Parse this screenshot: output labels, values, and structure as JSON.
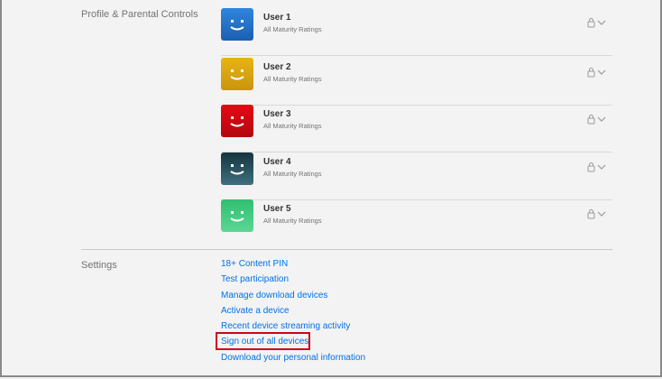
{
  "profiles_section": {
    "label": "Profile & Parental Controls",
    "users": [
      {
        "name": "User 1",
        "rating": "All Maturity Ratings",
        "color": "#2e86de",
        "color_dark": "#1c5fb0"
      },
      {
        "name": "User 2",
        "rating": "All Maturity Ratings",
        "color": "#e7b416",
        "color_dark": "#c9950e"
      },
      {
        "name": "User 3",
        "rating": "All Maturity Ratings",
        "color": "#e50914",
        "color_dark": "#b20710"
      },
      {
        "name": "User 4",
        "rating": "All Maturity Ratings",
        "color": "#15353f",
        "color_dark": "#3f6f7f"
      },
      {
        "name": "User 5",
        "rating": "All Maturity Ratings",
        "color": "#2fbf71",
        "color_dark": "#5cd693"
      }
    ],
    "row_icons": [
      "lock-icon",
      "chevron-down-icon"
    ]
  },
  "settings_section": {
    "label": "Settings",
    "links": [
      "18+ Content PIN",
      "Test participation",
      "Manage download devices",
      "Activate a device",
      "Recent device streaming activity",
      "Sign out of all devices",
      "Download your personal information"
    ],
    "highlighted_link": "Sign out of all devices",
    "link_color": "#0071eb",
    "highlight_color": "#d0021b"
  }
}
